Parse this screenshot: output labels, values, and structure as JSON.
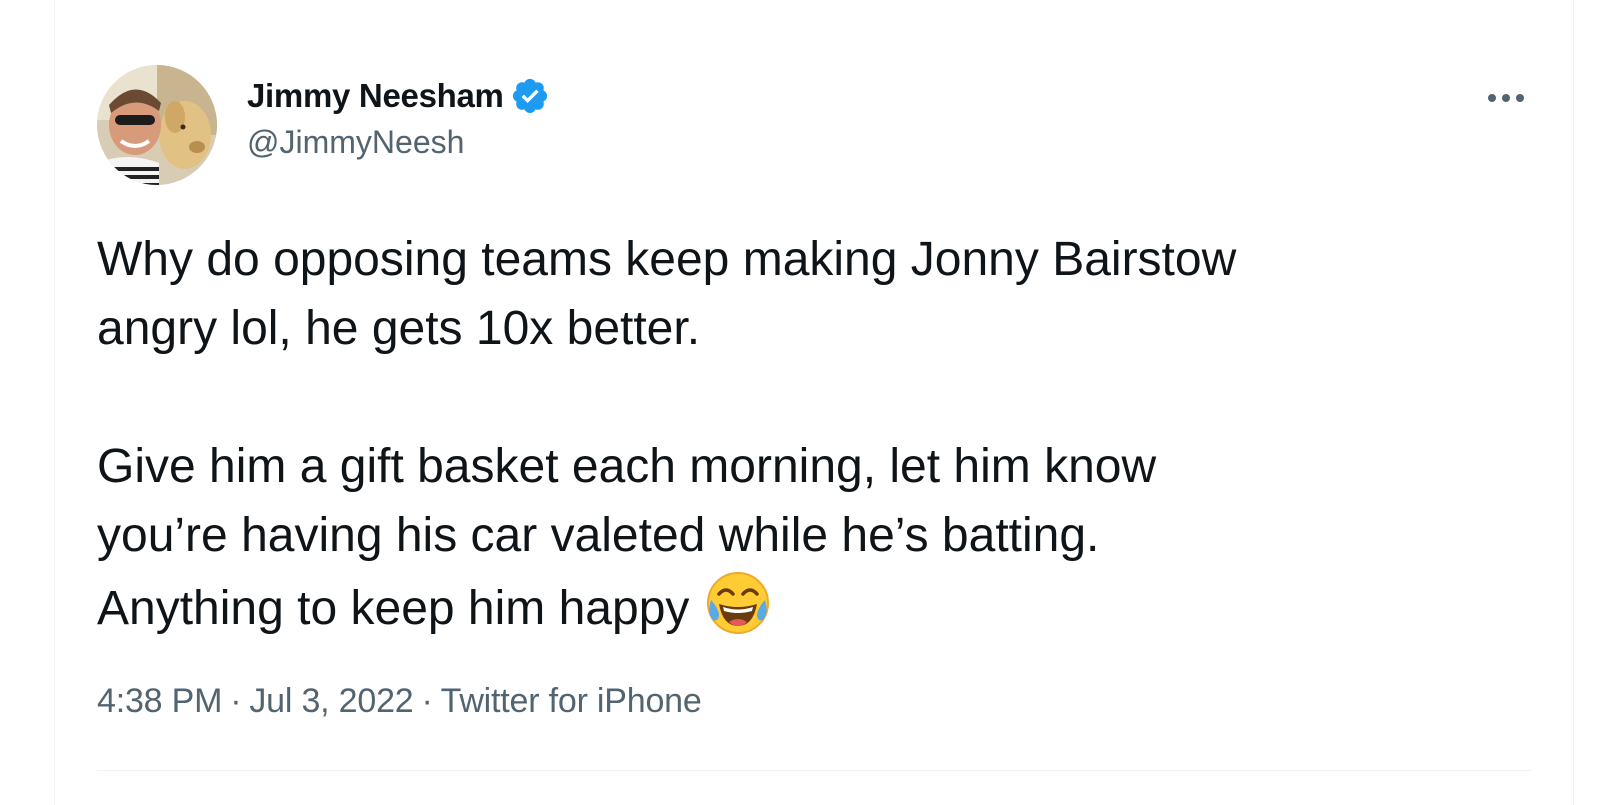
{
  "author": {
    "display_name": "Jimmy Neesham",
    "handle": "@JimmyNeesh",
    "verified_icon": "verified-badge-icon",
    "avatar": "profile-photo-avatar"
  },
  "menu": {
    "icon": "more-options-icon"
  },
  "tweet": {
    "paragraph_1_line_1": "Why do opposing teams keep making Jonny Bairstow",
    "paragraph_1_line_2": "angry lol, he gets 10x better.",
    "paragraph_2_line_1": "Give him a gift basket each morning, let him know",
    "paragraph_2_line_2": "you’re having his car valeted while he’s batting.",
    "paragraph_2_line_3": "Anything to keep him happy",
    "emoji": "face-with-tears-of-joy-icon"
  },
  "meta": {
    "time": "4:38 PM",
    "separator": "·",
    "date": "Jul 3, 2022",
    "source": "Twitter for iPhone"
  },
  "colors": {
    "text_primary": "#0f1419",
    "text_secondary": "#536471",
    "verified_blue": "#1d9bf0",
    "divider": "#eff3f4"
  }
}
